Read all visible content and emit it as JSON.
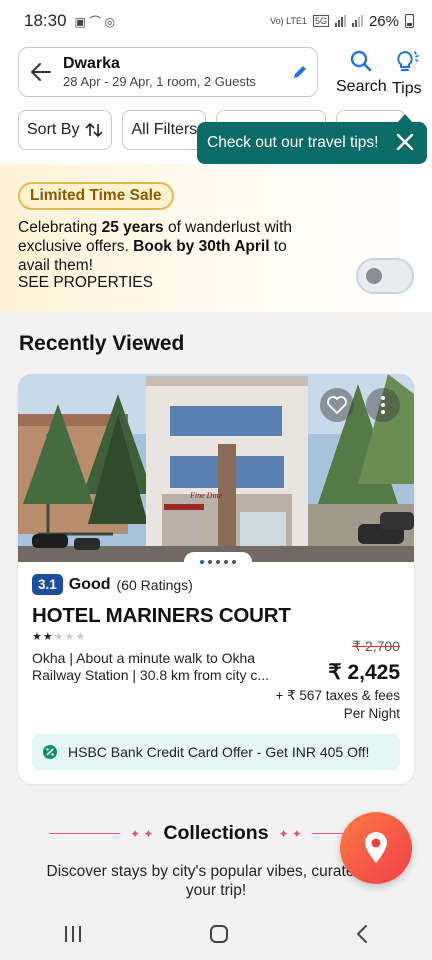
{
  "status_bar": {
    "time": "18:30",
    "network": "Vo) LTE1",
    "net_type": "5G",
    "battery": "26%"
  },
  "header": {
    "city": "Dwarka",
    "details": "28 Apr - 29 Apr, 1 room, 2 Guests",
    "search_label": "Search",
    "tips_label": "Tips"
  },
  "filters": {
    "sort_label": "Sort By",
    "all_filters_label": "All Filters"
  },
  "tooltip": {
    "text": "Check out our travel tips!"
  },
  "sale": {
    "badge": "Limited Time Sale",
    "line_prefix": "Celebrating ",
    "line_bold1": "25 years",
    "line_mid": " of wanderlust with exclusive offers. ",
    "line_bold2": "Book by 30th April",
    "line_suffix": " to avail them!",
    "cta": "SEE PROPERTIES",
    "toggle_on": false
  },
  "recently_viewed": {
    "title": "Recently Viewed",
    "hotel": {
      "sign_text": "Fine Dine",
      "rating": "3.1",
      "rating_word": "Good",
      "rating_count": "(60 Ratings)",
      "name": "HOTEL MARINERS COURT",
      "stars": 2,
      "location": "Okha | About a minute walk to Okha Railway Station | 30.8 km from city c...",
      "old_price": "₹ 2,700",
      "price": "₹ 2,425",
      "taxes": "+ ₹ 567 taxes & fees",
      "per_night": "Per Night",
      "offer": "HSBC Bank Credit Card Offer - Get INR 405 Off!"
    }
  },
  "collections": {
    "title": "Collections",
    "subtitle": "Discover stays by city's popular vibes, curated for your trip!"
  },
  "colors": {
    "accent_teal": "#0b6b66",
    "brand_blue": "#1d4fa0",
    "fab": "#ef3e4a"
  }
}
